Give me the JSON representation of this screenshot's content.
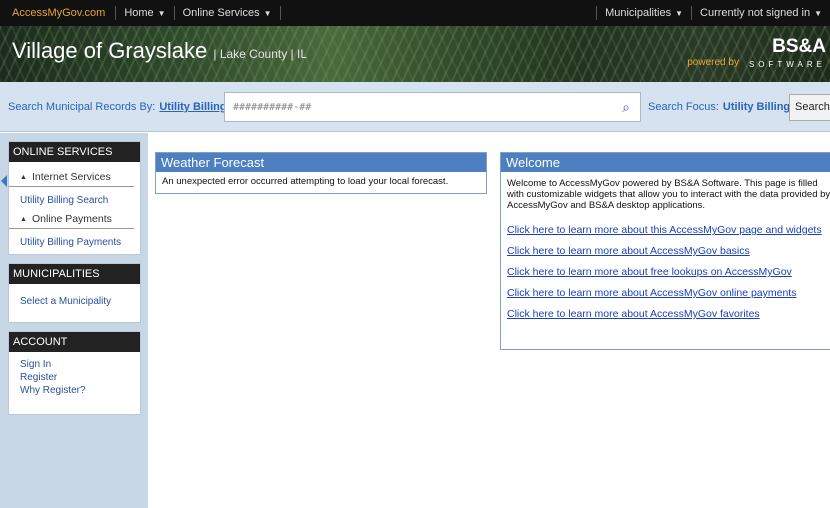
{
  "topbar": {
    "brand": "AccessMyGov.com",
    "home": "Home",
    "online_services": "Online Services",
    "municipalities": "Municipalities",
    "signin_status": "Currently not signed in"
  },
  "banner": {
    "title": "Village of Grayslake",
    "subtitle": "| Lake County | IL",
    "powered": "powered by",
    "logo": "BS&A",
    "logo_sub": "SOFTWARE"
  },
  "search": {
    "label": "Search Municipal Records By:",
    "by_value": "Utility Billing",
    "placeholder": "##########-##",
    "focus_label": "Search Focus:",
    "focus_value": "Utility Billing",
    "button": "Search"
  },
  "sidebar": {
    "online_services": {
      "header": "ONLINE SERVICES",
      "group1": "Internet Services",
      "item1": "Utility Billing Search",
      "group2": "Online Payments",
      "item2": "Utility Billing Payments"
    },
    "municipalities": {
      "header": "MUNICIPALITIES",
      "item": "Select a Municipality"
    },
    "account": {
      "header": "ACCOUNT",
      "items": [
        "Sign In",
        "Register",
        "Why Register?"
      ]
    }
  },
  "weather": {
    "title": "Weather Forecast",
    "message": "An unexpected error occurred attempting to load your local forecast."
  },
  "welcome": {
    "title": "Welcome",
    "text": "Welcome to AccessMyGov powered by BS&A Software. This page is filled with customizable widgets that allow you to interact with the data provided by AccessMyGov and BS&A desktop applications.",
    "links": [
      "Click here to learn more about this AccessMyGov page and widgets",
      "Click here to learn more about AccessMyGov basics",
      "Click here to learn more about free lookups on AccessMyGov",
      "Click here to learn more about AccessMyGov online payments",
      "Click here to learn more about AccessMyGov favorites"
    ]
  },
  "colors": {
    "widget_header": "#4d7fc1",
    "link": "#1a3fb8",
    "sidebar_bg": "#c8d7e6",
    "brand": "#e8a33c"
  }
}
